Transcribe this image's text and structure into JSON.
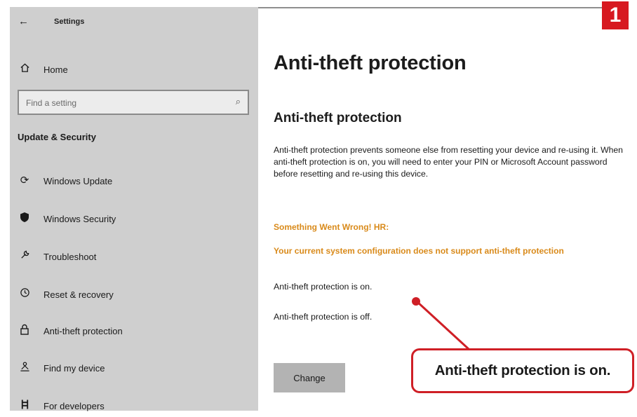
{
  "window": {
    "title": "Settings"
  },
  "sidebar": {
    "home_label": "Home",
    "search_placeholder": "Find a setting",
    "section_heading": "Update & Security",
    "items": [
      {
        "label": "Windows Update",
        "icon": "refresh-icon"
      },
      {
        "label": "Windows Security",
        "icon": "shield-icon"
      },
      {
        "label": "Troubleshoot",
        "icon": "wrench-icon"
      },
      {
        "label": "Reset & recovery",
        "icon": "history-icon"
      },
      {
        "label": "Anti-theft protection",
        "icon": "lock-icon"
      },
      {
        "label": "Find my device",
        "icon": "person-pin-icon"
      },
      {
        "label": "For developers",
        "icon": "developer-icon"
      }
    ]
  },
  "main": {
    "page_title": "Anti-theft protection",
    "sub_heading": "Anti-theft protection",
    "description": "Anti-theft protection prevents someone else from resetting your device and re-using it. When anti-theft protection is on, you will need to enter your PIN or Microsoft Account password before resetting and re-using this device.",
    "error_title": "Something Went Wrong! HR:",
    "error_message": "Your current system configuration does not support anti-theft protection",
    "status_on": "Anti-theft protection is on.",
    "status_off": "Anti-theft protection is off.",
    "change_button": "Change"
  },
  "annotation": {
    "badge": "1",
    "callout": "Anti-theft protection is on."
  },
  "colors": {
    "sidebar_bg": "#cfcfcf",
    "warning": "#d98a1a",
    "accent_red": "#d71920"
  }
}
